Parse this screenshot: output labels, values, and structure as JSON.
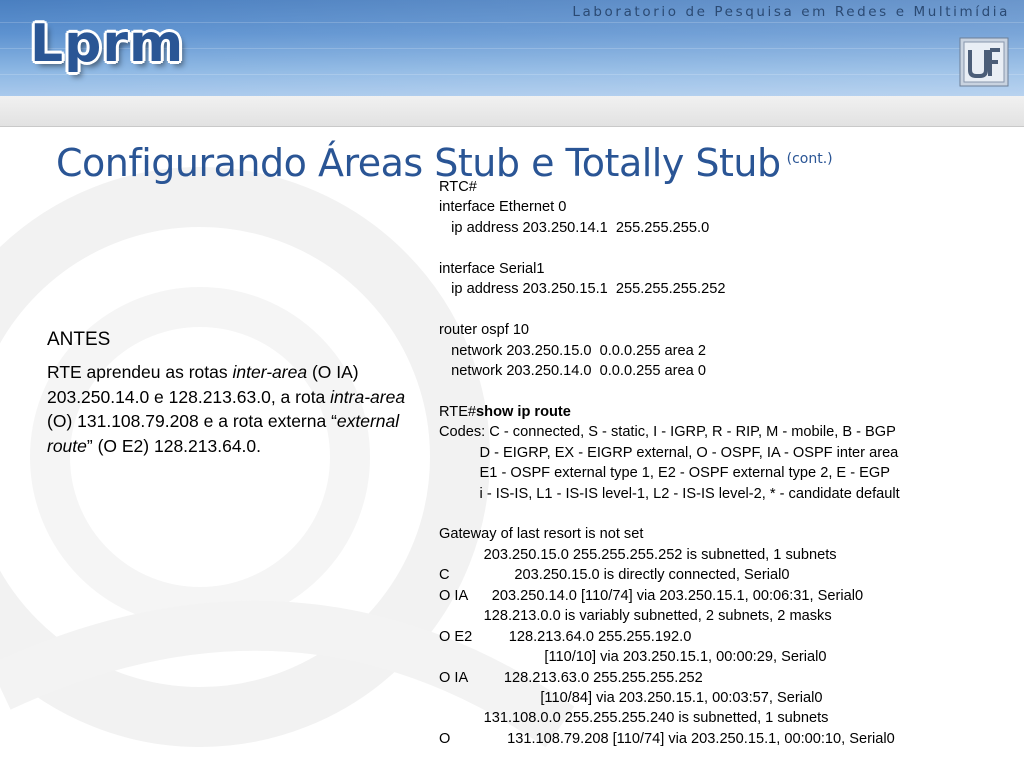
{
  "header": {
    "lab_name": "Laboratorio de Pesquisa em Redes e Multimídia",
    "logo_text": "Lprm",
    "partner_logo_text": "UFES"
  },
  "slide": {
    "title": "Configurando Áreas Stub e Totally Stub",
    "title_suffix": "(cont.)",
    "left": {
      "heading": "ANTES",
      "para_1": "RTE aprendeu as rotas ",
      "italic_1": "inter-area",
      "para_2": " (O IA) 203.250.14.0 e 128.213.63.0, a rota ",
      "italic_2": "intra-area",
      "para_3": " (O) 131.108.79.208 e a rota externa “",
      "italic_3": "external route",
      "para_4": "” (O E2) 128.213.64.0."
    },
    "code": {
      "prompt_rte": "RTE#",
      "command": "show ip route",
      "lines": [
        "RTC#",
        "interface Ethernet 0",
        "   ip address 203.250.14.1  255.255.255.0",
        "",
        "interface Serial1",
        "   ip address 203.250.15.1  255.255.255.252",
        "",
        "router ospf 10",
        "   network 203.250.15.0  0.0.0.255 area 2",
        "   network 203.250.14.0  0.0.0.255 area 0",
        "",
        "__RTE__",
        "Codes: C - connected, S - static, I - IGRP, R - RIP, M - mobile, B - BGP",
        "          D - EIGRP, EX - EIGRP external, O - OSPF, IA - OSPF inter area",
        "          E1 - OSPF external type 1, E2 - OSPF external type 2, E - EGP",
        "          i - IS-IS, L1 - IS-IS level-1, L2 - IS-IS level-2, * - candidate default",
        "",
        "Gateway of last resort is not set",
        "           203.250.15.0 255.255.255.252 is subnetted, 1 subnets",
        "C                203.250.15.0 is directly connected, Serial0",
        "O IA      203.250.14.0 [110/74] via 203.250.15.1, 00:06:31, Serial0",
        "           128.213.0.0 is variably subnetted, 2 subnets, 2 masks",
        "O E2         128.213.64.0 255.255.192.0",
        "                          [110/10] via 203.250.15.1, 00:00:29, Serial0",
        "O IA         128.213.63.0 255.255.255.252",
        "                         [110/84] via 203.250.15.1, 00:03:57, Serial0",
        "           131.108.0.0 255.255.255.240 is subnetted, 1 subnets",
        "O              131.108.79.208 [110/74] via 203.250.15.1, 00:00:10, Serial0"
      ]
    }
  }
}
